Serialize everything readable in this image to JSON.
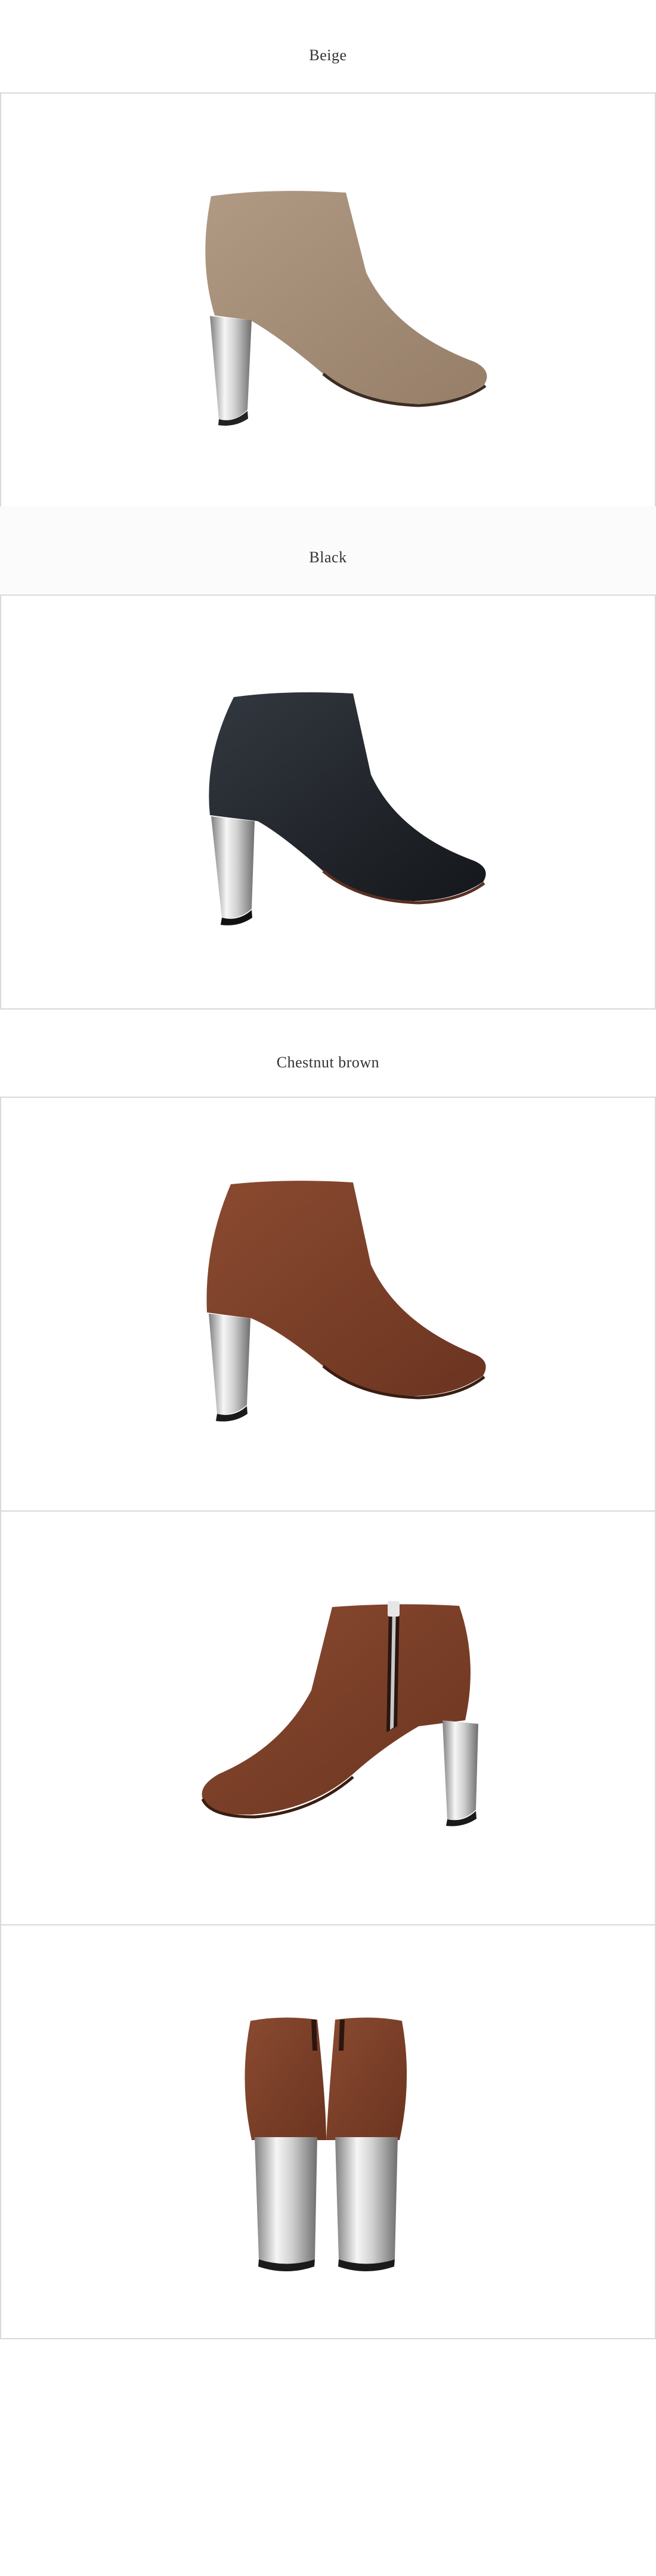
{
  "sections": [
    {
      "label": "Beige",
      "color": "#a08a75"
    },
    {
      "label": "Black",
      "color": "#23262b"
    },
    {
      "label": "Chestnut brown",
      "color": "#7c3f27"
    }
  ],
  "colors": {
    "border": "#d9d9d9",
    "label_text": "#333333",
    "chrome_light": "#f4f4f4",
    "chrome_dark": "#8a8a8a"
  },
  "images": [
    {
      "subject": "boot-side-view",
      "color": "Beige"
    },
    {
      "subject": "boot-side-view",
      "color": "Black"
    },
    {
      "subject": "boot-side-view",
      "color": "Chestnut brown"
    },
    {
      "subject": "boot-inner-zip-view",
      "color": "Chestnut brown"
    },
    {
      "subject": "boots-back-view",
      "color": "Chestnut brown"
    }
  ]
}
